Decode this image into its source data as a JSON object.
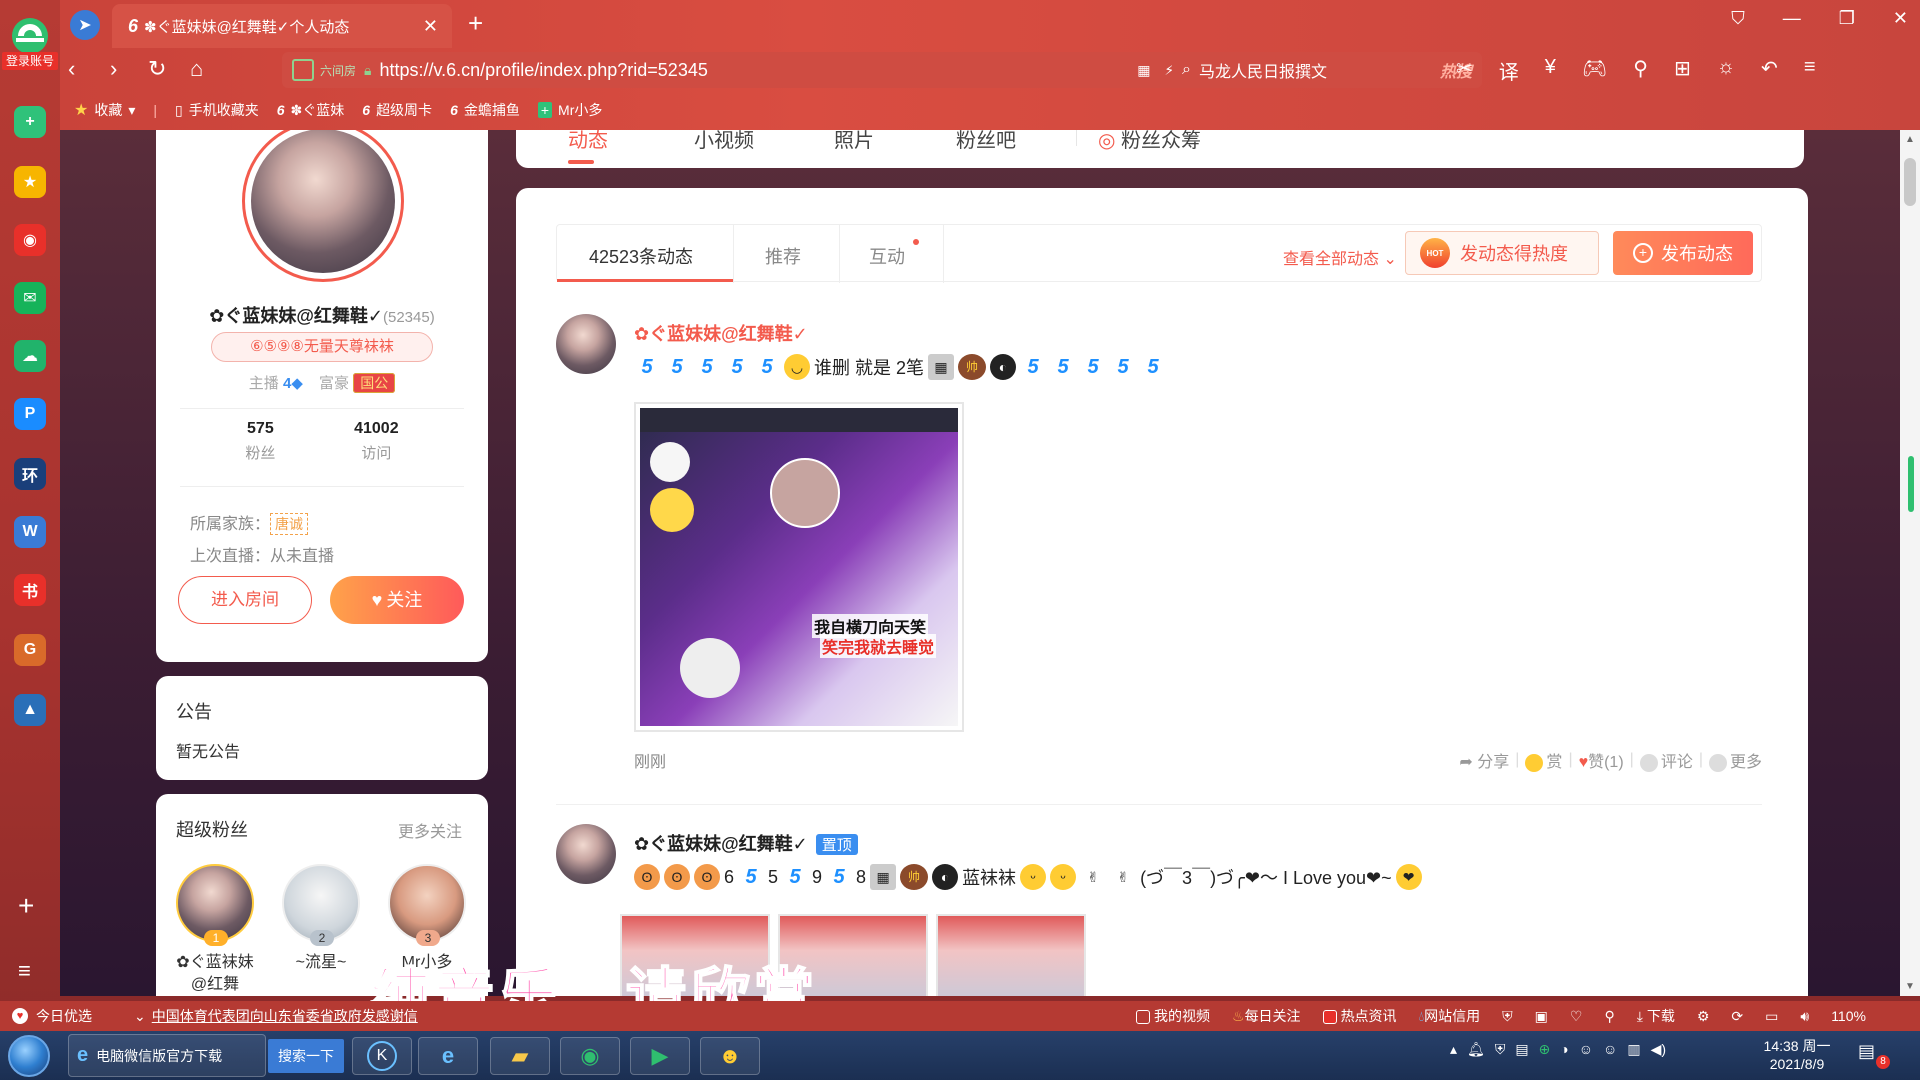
{
  "dock": {
    "badge": "登录账号",
    "items": [
      {
        "icon": "plus-square-icon",
        "color": "#2fc27a",
        "glyph": "+"
      },
      {
        "icon": "star-icon",
        "color": "#f7b500",
        "glyph": "★"
      },
      {
        "icon": "weibo-icon",
        "color": "#e8302a",
        "glyph": "◉"
      },
      {
        "icon": "mail-icon",
        "color": "#16b35a",
        "glyph": "✉"
      },
      {
        "icon": "cloud-icon",
        "color": "#21b36b",
        "glyph": "☁"
      },
      {
        "icon": "p-icon",
        "color": "#1a8cff",
        "glyph": "P"
      },
      {
        "icon": "globe-news-icon",
        "color": "#1a3f7a",
        "glyph": "环"
      },
      {
        "icon": "word-doc-icon",
        "color": "#3a7bd5",
        "glyph": "W"
      },
      {
        "icon": "xiaohongshu-icon",
        "color": "#e8302a",
        "glyph": "书"
      },
      {
        "icon": "game-icon",
        "color": "#d96a2a",
        "glyph": "G"
      },
      {
        "icon": "landscape-icon",
        "color": "#2a6fb8",
        "glyph": "▲"
      }
    ]
  },
  "browser": {
    "tab_title": "✽ぐ蓝妹妹@红舞鞋✓个人动态",
    "url": "https://v.6.cn/profile/index.php?rid=52345",
    "secure_label": "六间房",
    "search_text": "马龙人民日报撰文",
    "search_hot": "热搜"
  },
  "bookmarks": {
    "favorites": "收藏",
    "items": [
      "手机收藏夹",
      "✽ぐ蓝妹",
      "超级周卡",
      "金蟾捕鱼",
      "Mr小多"
    ]
  },
  "top_tabs": [
    "动态",
    "小视频",
    "照片",
    "粉丝吧",
    "粉丝众筹"
  ],
  "profile": {
    "nickname": "✿ぐ蓝妹妹@红舞鞋✓",
    "rid": "(52345)",
    "title_badge": "⑥⑤⑨⑧无量天尊袜袜",
    "anchor_label": "主播",
    "anchor_level": "4",
    "rich_label": "富豪",
    "rich_level": "国公",
    "fans_count": "575",
    "fans_label": "粉丝",
    "visits_count": "41002",
    "visits_label": "访问",
    "family_label": "所属家族：",
    "family_name": "唐诚",
    "last_live": "上次直播：从未直播",
    "enter_room": "进入房间",
    "follow": "关注"
  },
  "notice": {
    "title": "公告",
    "content": "暂无公告"
  },
  "super_fans": {
    "title": "超级粉丝",
    "more": "更多关注",
    "fans": [
      {
        "rank": "1",
        "name": "✿ぐ蓝袜妹@红舞"
      },
      {
        "rank": "2",
        "name": "~流星~"
      },
      {
        "rank": "3",
        "name": "Mr小多"
      }
    ]
  },
  "feed": {
    "tab_count": "42523条动态",
    "tab_recommend": "推荐",
    "tab_interact": "互动",
    "view_all": "查看全部动态",
    "hot_button": "发动态得热度",
    "hot_badge": "HOT",
    "post_button": "发布动态",
    "posts": [
      {
        "name": "✿ぐ蓝妹妹@红舞鞋✓",
        "text": "谁删 就是 2笔",
        "image_caption_1": "我自横刀向天笑",
        "image_caption_2": "笑完我就去睡觉",
        "time": "刚刚",
        "actions": {
          "share": "分享",
          "reward": "赏",
          "like": "赞(1)",
          "comment": "评论",
          "more": "更多"
        }
      },
      {
        "name": "✿ぐ蓝妹妹@红舞鞋✓",
        "pinned": "置顶",
        "text_a": "6",
        "text_b": "5",
        "text_c": "9",
        "text_d": "8",
        "text_e": "蓝袜袜",
        "text_f": "(づ￣3￣)づ╭❤～ I Love you❤~"
      }
    ]
  },
  "subtitle": "纯音乐，请欣赏",
  "statusbar": {
    "today": "今日优选",
    "news": "中国体育代表团向山东省委省政府发感谢信",
    "items": [
      "我的视频",
      "每日关注",
      "热点资讯",
      "网站信用",
      "下载"
    ],
    "zoom": "110%"
  },
  "taskbar": {
    "ie_item": "电脑微信版官方下载",
    "search_btn": "搜索一下",
    "time": "14:38 周一",
    "date": "2021/8/9",
    "notif_count": "8"
  },
  "colors": {
    "accent": "#f35b4d",
    "chrome": "#c9433a",
    "blue": "#3a8ef0"
  }
}
